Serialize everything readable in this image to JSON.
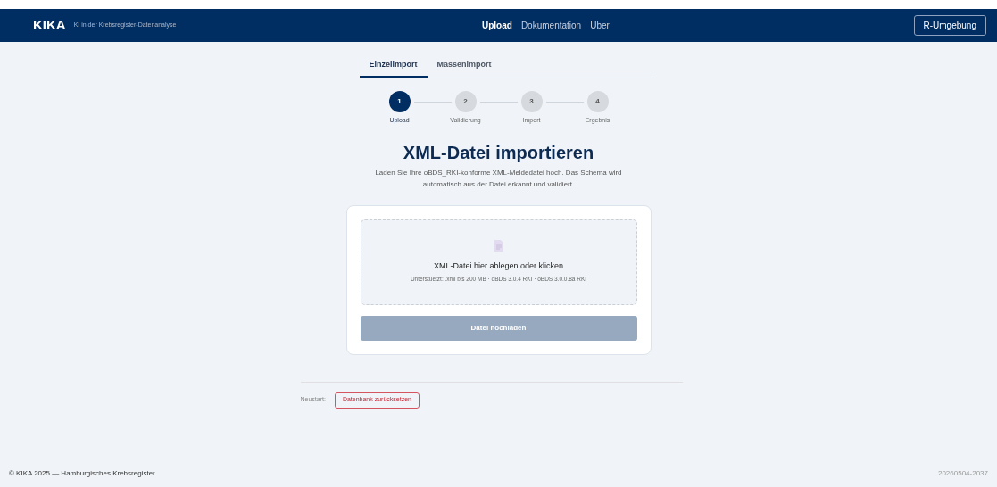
{
  "header": {
    "logo": "KIKA",
    "subtitle": "KI in der Krebsregister-Datenanalyse",
    "nav": [
      {
        "label": "Upload",
        "selected": true
      },
      {
        "label": "Dokumentation",
        "selected": false
      },
      {
        "label": "Über",
        "selected": false
      }
    ],
    "button": "R-Umgebung"
  },
  "tabs": [
    {
      "label": "Einzelimport",
      "selected": true
    },
    {
      "label": "Massenimport",
      "selected": false
    }
  ],
  "steps": [
    {
      "number": "1",
      "label": "Upload",
      "selected": true
    },
    {
      "number": "2",
      "label": "Validierung",
      "selected": false
    },
    {
      "number": "3",
      "label": "Import",
      "selected": false
    },
    {
      "number": "4",
      "label": "Ergebnis",
      "selected": false
    }
  ],
  "title": "XML-Datei importieren",
  "description": "Laden Sie Ihre oBDS_RKI-konforme XML-Meldedatei hoch. Das Schema wird automatisch aus der Datei erkannt und validiert.",
  "dropzone": {
    "title": "XML-Datei hier ablegen oder klicken",
    "hint": "Unterstuetzt: .xml bis 200 MB · oBDS 3.0.4 RKI · oBDS 3.0.0.8a RKI"
  },
  "upload_button": {
    "label": "Datei hochladen",
    "disabled": true
  },
  "reset": {
    "label": "Neustart:",
    "button": "Datenbank zurücksetzen"
  },
  "footer": {
    "copyright": "© KIKA 2025 — Hamburgisches Krebsregister",
    "version": "20260504-2037"
  }
}
